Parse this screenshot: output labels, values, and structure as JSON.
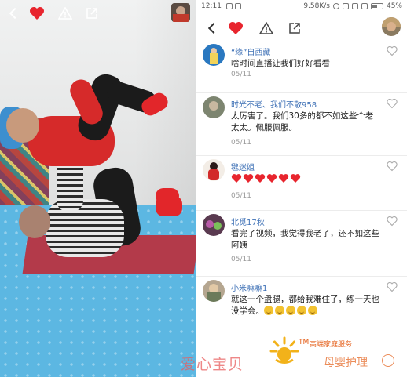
{
  "status_bar": {
    "time": "12:11",
    "speed": "9.58K/s",
    "battery": "45%"
  },
  "colors": {
    "like_red": "#e8252e",
    "name_blue": "#3c6fb5",
    "date_gray": "#9a9a9a"
  },
  "icons": {
    "back": "back-chevron-icon",
    "like": "heart-icon",
    "report": "warning-icon",
    "share": "share-icon"
  },
  "comments": [
    {
      "name": "“缘”自西藏",
      "text": "啥时间直播让我们好好看看",
      "date": "05/11",
      "emoji_count": 0
    },
    {
      "name": "时光不老、我们不散958",
      "text": "太厉害了。我们30多的都不如这些个老太太。佩服佩服。",
      "date": "05/11",
      "emoji_count": 0
    },
    {
      "name": "毽迷姐",
      "text": "",
      "date": "05/11",
      "emoji_count": 0,
      "hearts": 6
    },
    {
      "name": "北觅17秋",
      "text": "看完了视频，我觉得我老了，还不如这些阿姨",
      "date": "05/11",
      "emoji_count": 0
    },
    {
      "name": "小米嘛嘛1",
      "text": "就这一个盘腿，都给我难住了，练一天也没学会。",
      "date": "",
      "emoji_count": 5
    }
  ],
  "watermark": {
    "brand": "爱心宝贝",
    "tm": "TM",
    "subtitle": "高端家庭服务",
    "service": "母婴护理"
  }
}
